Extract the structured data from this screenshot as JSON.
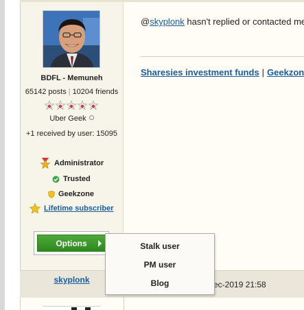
{
  "post": {
    "message_prefix": "@",
    "mention": "skyplonk",
    "message_rest": " hasn't replied or contacted me",
    "signature": {
      "link1": "Sharesies investment funds",
      "separator": "|",
      "link2": "Geekzone"
    }
  },
  "user_card": {
    "avatar_icon": "user-avatar-photo",
    "name": "BDFL - Memuneh",
    "posts": "65142 posts",
    "friends": "10204 friends",
    "star_rating": 5,
    "rank": "Uber Geek",
    "received": "+1 received by user: 15095",
    "badges": {
      "admin": "Administrator",
      "trusted": "Trusted",
      "geekzone": "Geekzone",
      "lifetime": "Lifetime subscriber"
    },
    "options_label": "Options"
  },
  "options_menu": {
    "items": [
      "Stalk user",
      "PM user",
      "Blog"
    ]
  },
  "next_post": {
    "username": "skyplonk",
    "date_fragment": "ec-2019 21:58"
  },
  "colors": {
    "link": "#1a5c9e",
    "options_green": "#3a9a2a",
    "user_column_bg": "#f7f4e9",
    "next_band_bg": "#eae6da"
  }
}
